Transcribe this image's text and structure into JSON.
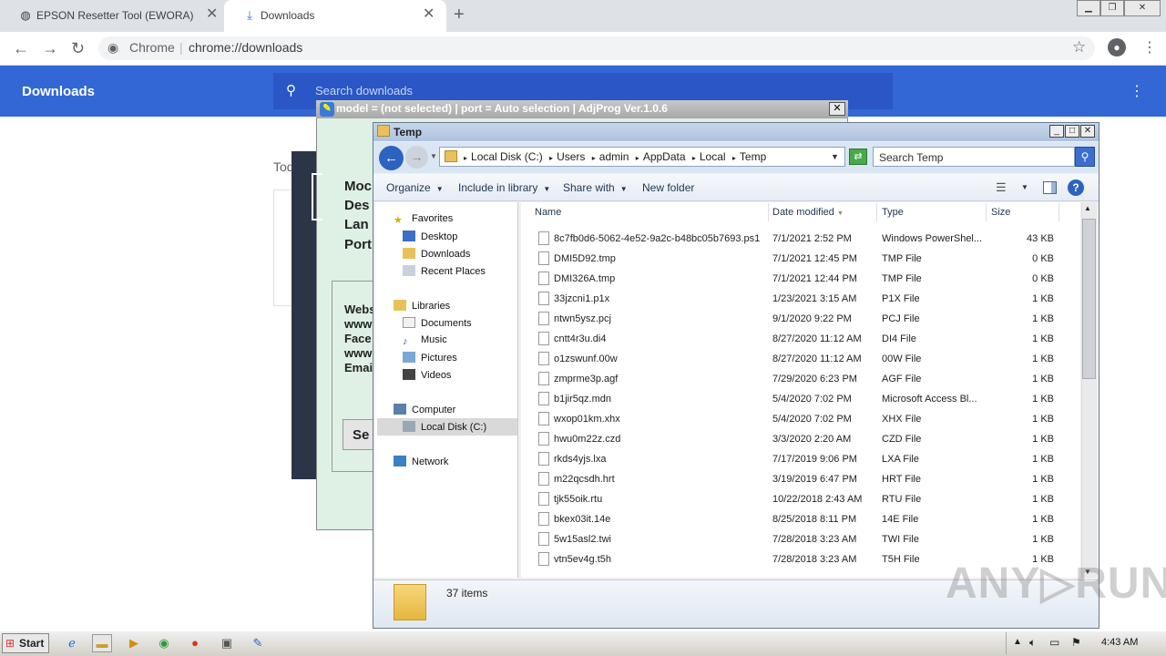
{
  "chrome": {
    "tabs": [
      {
        "label": "EPSON Resetter Tool (EWORA)"
      },
      {
        "label": "Downloads"
      }
    ],
    "new_tab": "+",
    "omnibox": {
      "site": "Chrome",
      "sep": "|",
      "url": "chrome://downloads"
    }
  },
  "downloads_page": {
    "title": "Downloads",
    "search_placeholder": "Search downloads",
    "today": "Tod"
  },
  "adjprog": {
    "title": "model = (not selected) | port = Auto selection | AdjProg Ver.1.0.6",
    "labels": [
      "Moc",
      "Des",
      "Lan",
      "Port"
    ],
    "info_labels": [
      "Webs",
      "www",
      "Face",
      "www",
      "Emai"
    ],
    "button": "Se"
  },
  "explorer": {
    "title": "Temp",
    "breadcrumb": [
      "Local Disk (C:)",
      "Users",
      "admin",
      "AppData",
      "Local",
      "Temp"
    ],
    "search_placeholder": "Search Temp",
    "commands": [
      "Organize",
      "Include in library",
      "Share with",
      "New folder"
    ],
    "nav": {
      "favorites": "Favorites",
      "favorites_items": [
        "Desktop",
        "Downloads",
        "Recent Places"
      ],
      "libraries": "Libraries",
      "libraries_items": [
        "Documents",
        "Music",
        "Pictures",
        "Videos"
      ],
      "computer": "Computer",
      "computer_items": [
        "Local Disk (C:)"
      ],
      "network": "Network"
    },
    "columns": {
      "name": "Name",
      "date": "Date modified",
      "type": "Type",
      "size": "Size"
    },
    "files": [
      {
        "name": "8c7fb0d6-5062-4e52-9a2c-b48bc05b7693.ps1",
        "date": "7/1/2021 2:52 PM",
        "type": "Windows PowerShel...",
        "size": "43 KB"
      },
      {
        "name": "DMI5D92.tmp",
        "date": "7/1/2021 12:45 PM",
        "type": "TMP File",
        "size": "0 KB"
      },
      {
        "name": "DMI326A.tmp",
        "date": "7/1/2021 12:44 PM",
        "type": "TMP File",
        "size": "0 KB"
      },
      {
        "name": "33jzcni1.p1x",
        "date": "1/23/2021 3:15 AM",
        "type": "P1X File",
        "size": "1 KB"
      },
      {
        "name": "ntwn5ysz.pcj",
        "date": "9/1/2020 9:22 PM",
        "type": "PCJ File",
        "size": "1 KB"
      },
      {
        "name": "cntt4r3u.di4",
        "date": "8/27/2020 11:12 AM",
        "type": "DI4 File",
        "size": "1 KB"
      },
      {
        "name": "o1zswunf.00w",
        "date": "8/27/2020 11:12 AM",
        "type": "00W File",
        "size": "1 KB"
      },
      {
        "name": "zmprme3p.agf",
        "date": "7/29/2020 6:23 PM",
        "type": "AGF File",
        "size": "1 KB"
      },
      {
        "name": "b1jir5qz.mdn",
        "date": "5/4/2020 7:02 PM",
        "type": "Microsoft Access Bl...",
        "size": "1 KB"
      },
      {
        "name": "wxop01km.xhx",
        "date": "5/4/2020 7:02 PM",
        "type": "XHX File",
        "size": "1 KB"
      },
      {
        "name": "hwu0m22z.czd",
        "date": "3/3/2020 2:20 AM",
        "type": "CZD File",
        "size": "1 KB"
      },
      {
        "name": "rkds4yjs.lxa",
        "date": "7/17/2019 9:06 PM",
        "type": "LXA File",
        "size": "1 KB"
      },
      {
        "name": "m22qcsdh.hrt",
        "date": "3/19/2019 6:47 PM",
        "type": "HRT File",
        "size": "1 KB"
      },
      {
        "name": "tjk55oik.rtu",
        "date": "10/22/2018 2:43 AM",
        "type": "RTU File",
        "size": "1 KB"
      },
      {
        "name": "bkex03it.14e",
        "date": "8/25/2018 8:11 PM",
        "type": "14E File",
        "size": "1 KB"
      },
      {
        "name": "5w15asl2.twi",
        "date": "7/28/2018 3:23 AM",
        "type": "TWI File",
        "size": "1 KB"
      },
      {
        "name": "vtn5ev4g.t5h",
        "date": "7/28/2018 3:23 AM",
        "type": "T5H File",
        "size": "1 KB"
      }
    ],
    "item_count": "37 items"
  },
  "taskbar": {
    "start": "Start",
    "clock": "4:43 AM"
  },
  "watermark": "ANY RUN"
}
